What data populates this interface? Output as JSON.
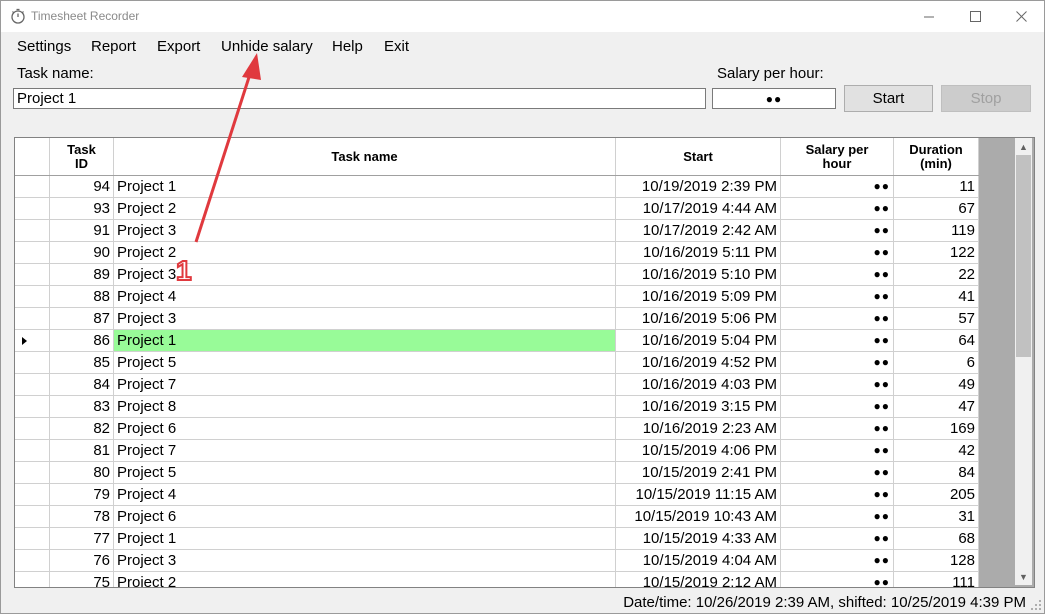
{
  "window": {
    "title": "Timesheet Recorder"
  },
  "menu": [
    {
      "label": "Settings"
    },
    {
      "label": "Report"
    },
    {
      "label": "Export"
    },
    {
      "label": "Unhide salary"
    },
    {
      "label": "Help"
    },
    {
      "label": "Exit"
    }
  ],
  "form": {
    "task_name_label": "Task name:",
    "task_name_value": "Project 1",
    "salary_label": "Salary per hour:",
    "salary_value": "●●",
    "start_label": "Start",
    "stop_label": "Stop"
  },
  "table": {
    "columns": [
      "Task ID",
      "Task name",
      "Start",
      "Salary per hour",
      "Duration (min)"
    ],
    "columns_display": [
      "Task\nID",
      "Task name",
      "Start",
      "Salary per\nhour",
      "Duration\n(min)"
    ],
    "rows": [
      {
        "id": "94",
        "name": "Project 1",
        "start": "10/19/2019 2:39 PM",
        "salary": "●●",
        "duration": "11"
      },
      {
        "id": "93",
        "name": "Project 2",
        "start": "10/17/2019 4:44 AM",
        "salary": "●●",
        "duration": "67"
      },
      {
        "id": "91",
        "name": "Project 3",
        "start": "10/17/2019 2:42 AM",
        "salary": "●●",
        "duration": "119"
      },
      {
        "id": "90",
        "name": "Project 2",
        "start": "10/16/2019 5:11 PM",
        "salary": "●●",
        "duration": "122"
      },
      {
        "id": "89",
        "name": "Project 3",
        "start": "10/16/2019 5:10 PM",
        "salary": "●●",
        "duration": "22"
      },
      {
        "id": "88",
        "name": "Project 4",
        "start": "10/16/2019 5:09 PM",
        "salary": "●●",
        "duration": "41"
      },
      {
        "id": "87",
        "name": "Project 3",
        "start": "10/16/2019 5:06 PM",
        "salary": "●●",
        "duration": "57"
      },
      {
        "id": "86",
        "name": "Project 1",
        "start": "10/16/2019 5:04 PM",
        "salary": "●●",
        "duration": "64",
        "selected": true
      },
      {
        "id": "85",
        "name": "Project 5",
        "start": "10/16/2019 4:52 PM",
        "salary": "●●",
        "duration": "6"
      },
      {
        "id": "84",
        "name": "Project 7",
        "start": "10/16/2019 4:03 PM",
        "salary": "●●",
        "duration": "49"
      },
      {
        "id": "83",
        "name": "Project 8",
        "start": "10/16/2019 3:15 PM",
        "salary": "●●",
        "duration": "47"
      },
      {
        "id": "82",
        "name": "Project 6",
        "start": "10/16/2019 2:23 AM",
        "salary": "●●",
        "duration": "169"
      },
      {
        "id": "81",
        "name": "Project 7",
        "start": "10/15/2019 4:06 PM",
        "salary": "●●",
        "duration": "42"
      },
      {
        "id": "80",
        "name": "Project 5",
        "start": "10/15/2019 2:41 PM",
        "salary": "●●",
        "duration": "84"
      },
      {
        "id": "79",
        "name": "Project 4",
        "start": "10/15/2019 11:15 AM",
        "salary": "●●",
        "duration": "205"
      },
      {
        "id": "78",
        "name": "Project 6",
        "start": "10/15/2019 10:43 AM",
        "salary": "●●",
        "duration": "31"
      },
      {
        "id": "77",
        "name": "Project 1",
        "start": "10/15/2019 4:33 AM",
        "salary": "●●",
        "duration": "68"
      },
      {
        "id": "76",
        "name": "Project 3",
        "start": "10/15/2019 4:04 AM",
        "salary": "●●",
        "duration": "128"
      },
      {
        "id": "75",
        "name": "Project 2",
        "start": "10/15/2019 2:12 AM",
        "salary": "●●",
        "duration": "111"
      }
    ]
  },
  "status": {
    "text": "Date/time: 10/26/2019 2:39 AM, shifted: 10/25/2019 4:39 PM"
  },
  "annotation": {
    "number": "1",
    "color": "#e0393e"
  },
  "icons": {
    "app": "stopwatch-icon",
    "minimize": "minimize-icon",
    "maximize": "maximize-icon",
    "close": "close-icon",
    "row_pointer": "row-pointer-icon"
  }
}
